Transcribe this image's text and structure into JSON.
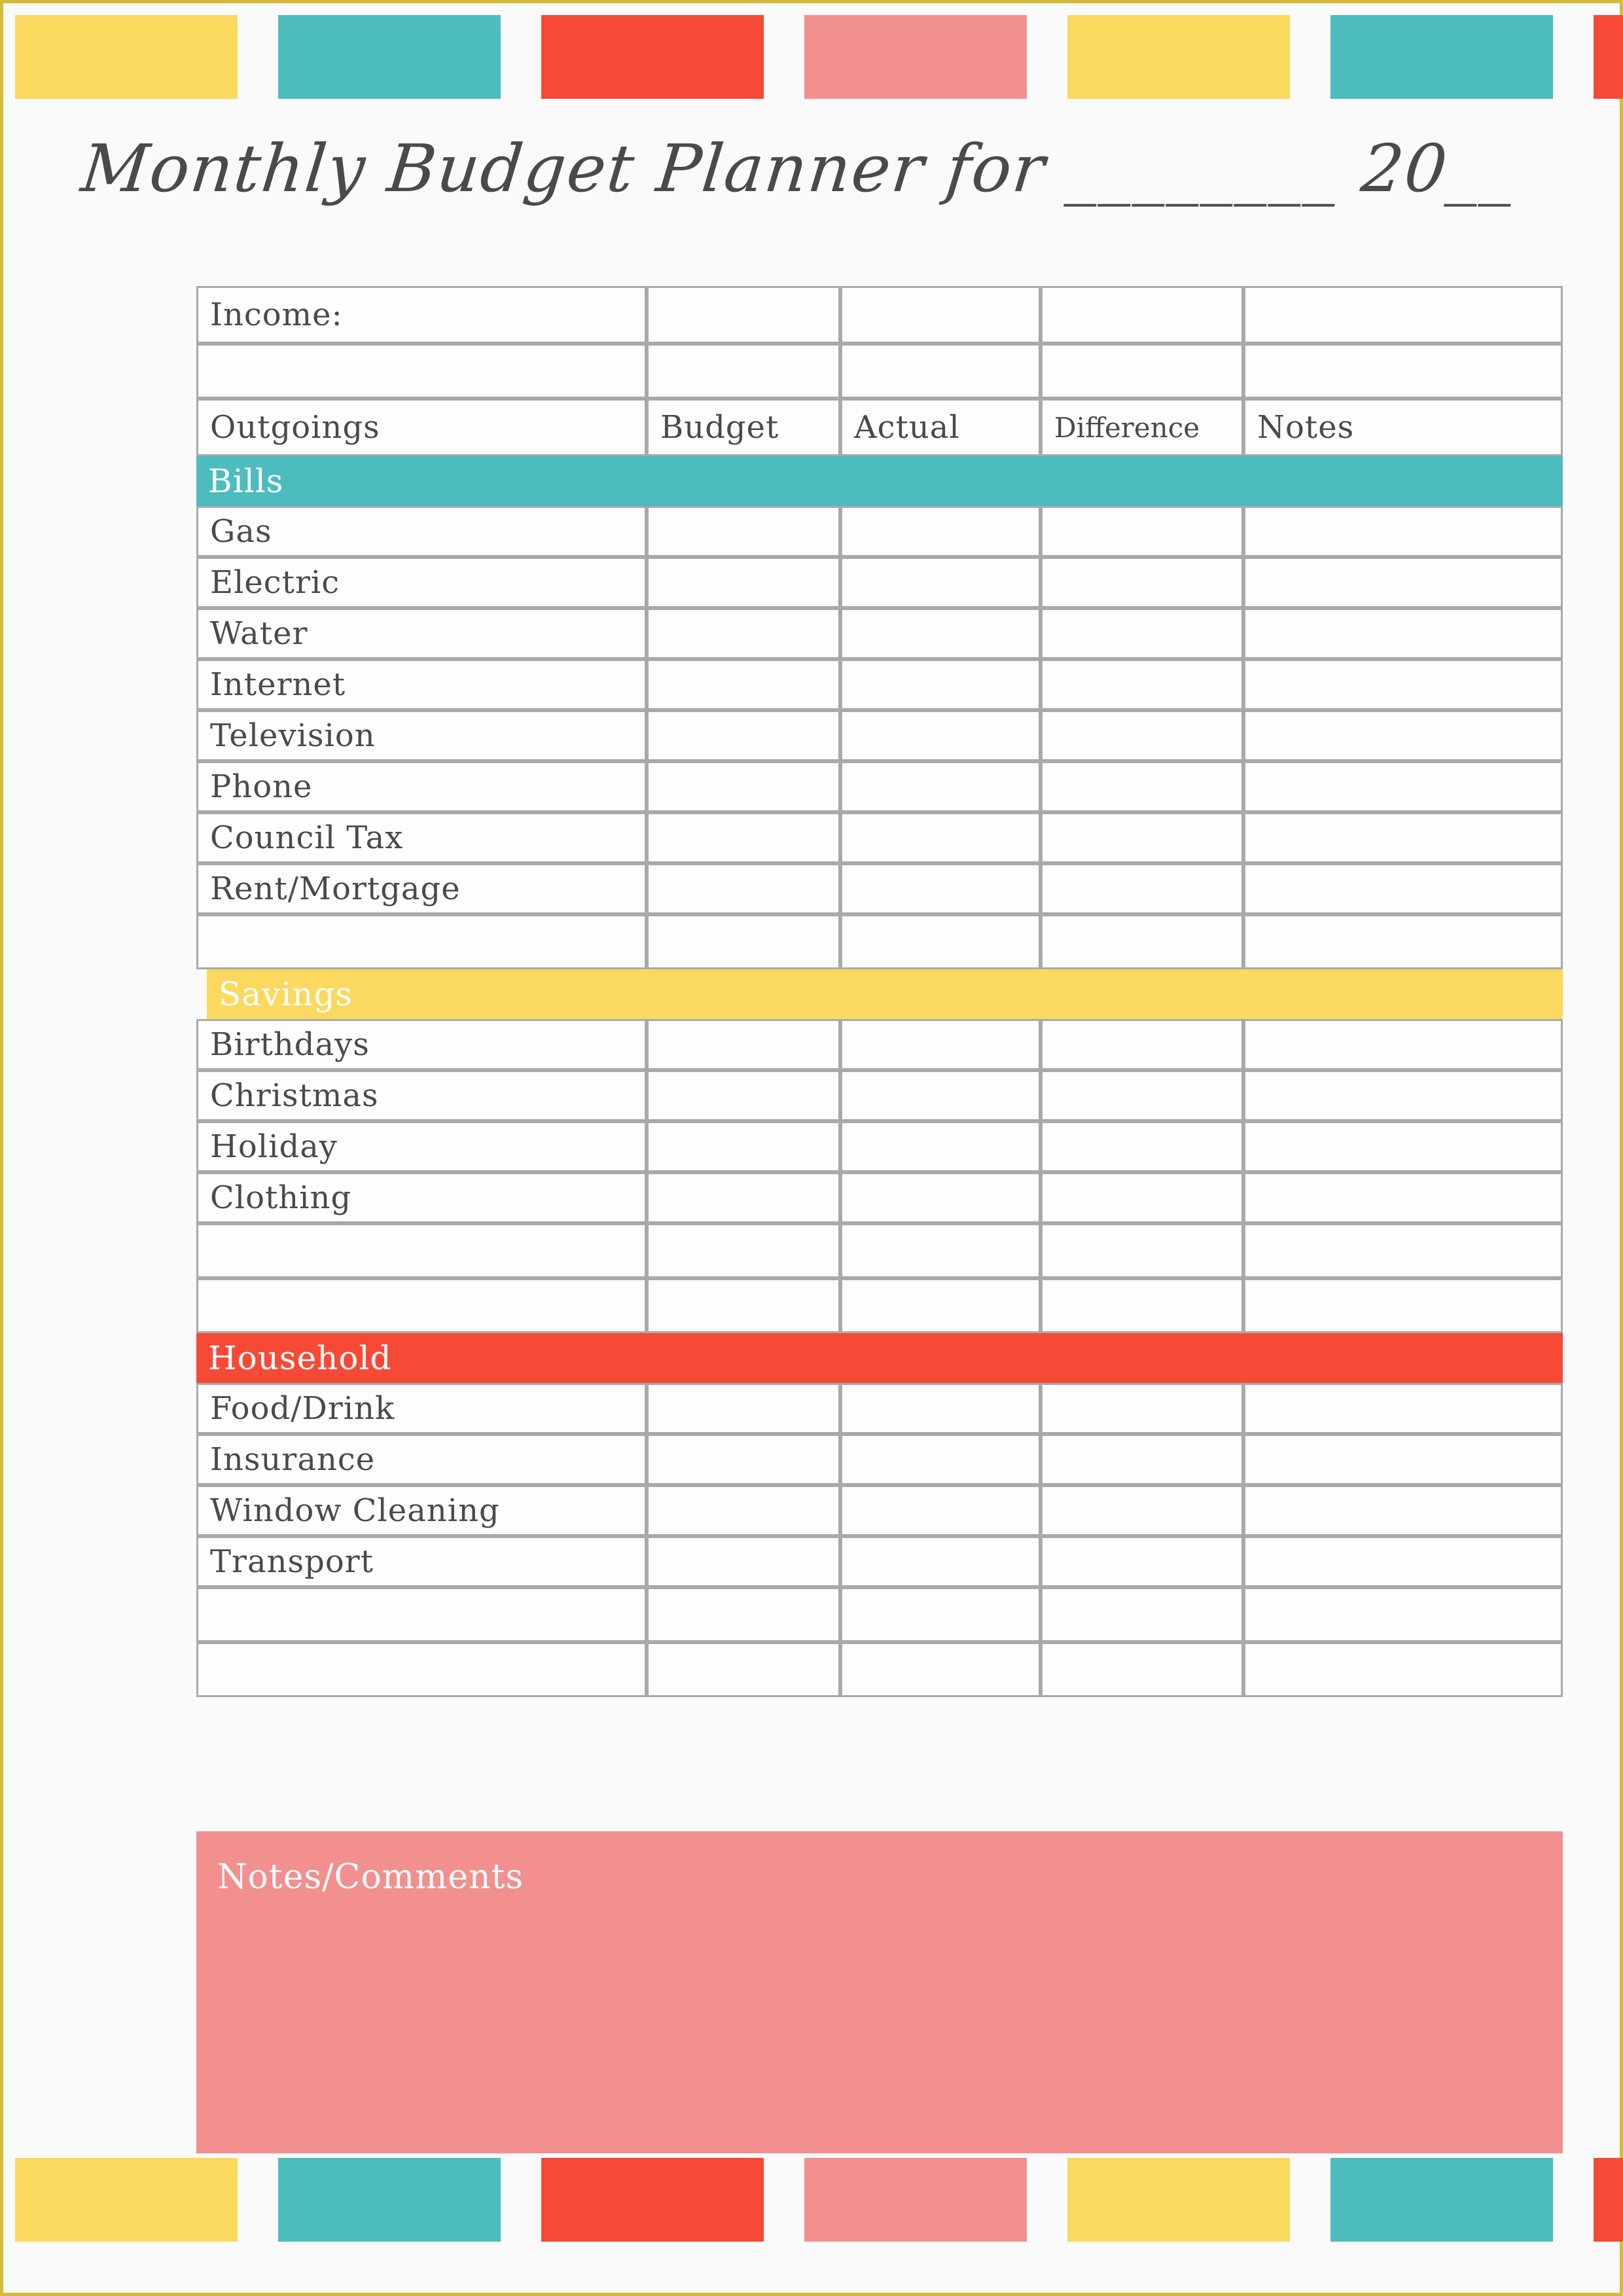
{
  "page": {
    "background_color": "#fbfafa",
    "border_color": "#d6ba3c"
  },
  "title": {
    "text": "Monthly Budget Planner for ________ 20__"
  },
  "palette": {
    "yellow": "#fbd85e",
    "teal": "#4cbcbe",
    "red": "#f74a36",
    "pink": "#f28f8f",
    "gold_border": "#d6ba3c",
    "grid_line": "#a9a9a9",
    "text": "#4a4a4a"
  },
  "decor_strip_top": [
    {
      "color": "#fbd85e",
      "name": "yellow"
    },
    {
      "color": "#4cbcbe",
      "name": "teal"
    },
    {
      "color": "#f74a36",
      "name": "red"
    },
    {
      "color": "#f28f8f",
      "name": "pink"
    },
    {
      "color": "#fbd85e",
      "name": "yellow"
    },
    {
      "color": "#4cbcbe",
      "name": "teal"
    },
    {
      "color": "#f74a36",
      "name": "red"
    }
  ],
  "decor_strip_bottom": [
    {
      "color": "#fbd85e",
      "name": "yellow"
    },
    {
      "color": "#4cbcbe",
      "name": "teal"
    },
    {
      "color": "#f74a36",
      "name": "red"
    },
    {
      "color": "#f28f8f",
      "name": "pink"
    },
    {
      "color": "#fbd85e",
      "name": "yellow"
    },
    {
      "color": "#4cbcbe",
      "name": "teal"
    },
    {
      "color": "#f74a36",
      "name": "red"
    }
  ],
  "table": {
    "income_label": "Income:",
    "columns": [
      "Outgoings",
      "Budget",
      "Actual",
      "Difference",
      "Notes"
    ],
    "sections": [
      {
        "name": "Bills",
        "color": "#4cbcbe",
        "rows": [
          "Gas",
          "Electric",
          "Water",
          "Internet",
          "Television",
          "Phone",
          "Council Tax",
          "Rent/Mortgage",
          ""
        ]
      },
      {
        "name": "Savings",
        "color": "#fbd85e",
        "rows": [
          "Birthdays",
          "Christmas",
          "Holiday",
          "Clothing",
          "",
          ""
        ]
      },
      {
        "name": "Household",
        "color": "#f74a36",
        "rows": [
          "Food/Drink",
          "Insurance",
          "Window Cleaning",
          "Transport",
          "",
          ""
        ]
      }
    ]
  },
  "notes": {
    "title": "Notes/Comments",
    "color": "#f28f8f"
  }
}
